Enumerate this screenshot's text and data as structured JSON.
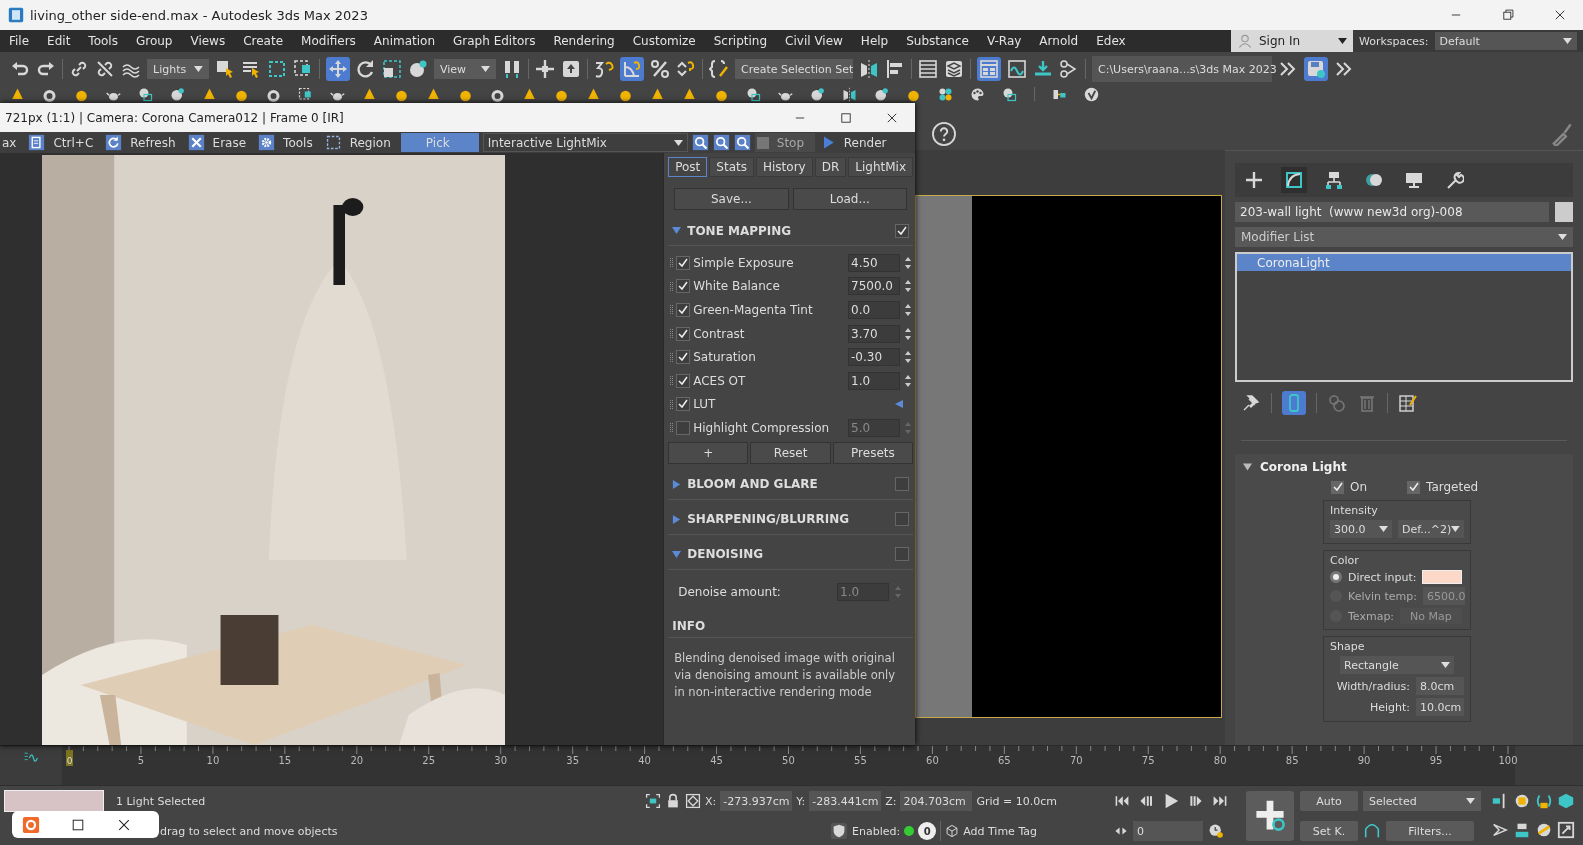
{
  "window": {
    "title": "living_other side-end.max - Autodesk 3ds Max 2023"
  },
  "menu": [
    "File",
    "Edit",
    "Tools",
    "Group",
    "Views",
    "Create",
    "Modifiers",
    "Animation",
    "Graph Editors",
    "Rendering",
    "Customize",
    "Scripting",
    "Civil View",
    "Help",
    "Substance",
    "V-Ray",
    "Arnold",
    "Edex"
  ],
  "account": {
    "sign_in": "Sign In",
    "workspaces_label": "Workspaces:",
    "workspace": "Default"
  },
  "toolbar": {
    "selection_filter": "Lights",
    "reference_coordinates": "View",
    "selection_set": "Create Selection Set",
    "project_path": "C:\\Users\\raana...s\\3ds Max 2023"
  },
  "frame_buffer": {
    "title": "721px (1:1) | Camera: Corona Camera012 | Frame 0 [IR]",
    "tools": [
      {
        "label": "ax",
        "kind": "text",
        "selected": false
      },
      {
        "label": "Ctrl+C",
        "kind": "copy",
        "selected": false
      },
      {
        "label": "Refresh",
        "kind": "refresh",
        "selected": false
      },
      {
        "label": "Erase",
        "kind": "erase",
        "selected": false
      },
      {
        "label": "Tools",
        "kind": "gear",
        "selected": false
      },
      {
        "label": "Region",
        "kind": "region",
        "selected": false
      },
      {
        "label": "Pick",
        "kind": "text",
        "selected": true
      }
    ],
    "mode": "Interactive LightMix",
    "stop": {
      "label": "Stop",
      "disabled": true
    },
    "render": "Render",
    "tabs": [
      {
        "label": "Post",
        "selected": true
      },
      {
        "label": "Stats",
        "selected": false
      },
      {
        "label": "History",
        "selected": false
      },
      {
        "label": "DR",
        "selected": false
      },
      {
        "label": "LightMix",
        "selected": false
      }
    ],
    "save": "Save...",
    "load": "Load...",
    "sections": [
      {
        "title": "TONE MAPPING",
        "kind": "tone",
        "expanded": true,
        "checked": true,
        "rows": [
          {
            "label": "Simple Exposure",
            "checked": true,
            "kind": "spinner",
            "value": "4.50"
          },
          {
            "label": "White Balance",
            "checked": true,
            "kind": "spinner",
            "value": "7500.0"
          },
          {
            "label": "Green-Magenta Tint",
            "checked": true,
            "kind": "spinner",
            "value": "0.0"
          },
          {
            "label": "Contrast",
            "checked": true,
            "kind": "spinner",
            "value": "3.70"
          },
          {
            "label": "Saturation",
            "checked": true,
            "kind": "spinner",
            "value": "-0.30"
          },
          {
            "label": "ACES OT",
            "checked": true,
            "kind": "spinner",
            "value": "1.0"
          },
          {
            "label": "LUT",
            "checked": true,
            "kind": "lut"
          },
          {
            "label": "Highlight Compression",
            "checked": false,
            "kind": "spinner",
            "value": "5.0"
          }
        ],
        "buttons": [
          "+",
          "Reset",
          "Presets"
        ]
      },
      {
        "title": "BLOOM AND GLARE",
        "kind": "plain",
        "expanded": false,
        "checked": false
      },
      {
        "title": "SHARPENING/BLURRING",
        "kind": "plain",
        "expanded": false,
        "checked": false
      },
      {
        "title": "DENOISING",
        "kind": "denoise",
        "expanded": true,
        "checked": false,
        "field": {
          "label": "Denoise amount:",
          "value": "1.0"
        }
      }
    ],
    "info": {
      "title": "INFO",
      "text": "Blending denoised image with original via denoising amount is available only in non-interactive rendering mode"
    }
  },
  "command_panel": {
    "object_name": "203-wall light  (www new3d org)-008",
    "modifier_list": "Modifier List",
    "stack": [
      {
        "label": "CoronaLight",
        "selected": true
      }
    ],
    "rollout": {
      "title": "Corona Light",
      "on": {
        "label": "On",
        "checked": true
      },
      "targeted": {
        "label": "Targeted",
        "checked": true
      },
      "intensity": {
        "title": "Intensity",
        "value": "300.0",
        "unit": "Def...^2)"
      },
      "color": {
        "title": "Color",
        "options": [
          {
            "label": "Direct input:",
            "selected": true,
            "kind": "swatch"
          },
          {
            "label": "Kelvin temp:",
            "selected": false,
            "kind": "kelvin",
            "value": "6500.0"
          },
          {
            "label": "Texmap:",
            "selected": false,
            "kind": "map",
            "value": "No Map"
          }
        ]
      },
      "shape": {
        "title": "Shape",
        "type": "Rectangle",
        "width_label": "Width/radius:",
        "width": "8.0cm",
        "height_label": "Height:",
        "height": "10.0cm"
      }
    }
  },
  "timeline": {
    "current": "0",
    "level": 0,
    "labels": [
      "5",
      "10",
      "15",
      "20",
      "25",
      "30",
      "35",
      "40",
      "45",
      "50",
      "55",
      "60",
      "65",
      "70",
      "75",
      "80",
      "85",
      "90",
      "95",
      "100"
    ]
  },
  "status": {
    "selection": "1 Light Selected",
    "prompt": "drag to select and move objects",
    "x": "-273.937cm",
    "y": "-283.441cm",
    "z": "204.703cm",
    "x_label": "X:",
    "y_label": "Y:",
    "z_label": "Z:",
    "grid": "Grid = 10.0cm",
    "enabled_label": "Enabled:",
    "enabled": true,
    "tag_count": "0",
    "time_tag": "Add Time Tag",
    "frame": "0",
    "auto": "Auto",
    "set_key": "Set K.",
    "key_filter": "Selected",
    "filters": "Filters..."
  }
}
